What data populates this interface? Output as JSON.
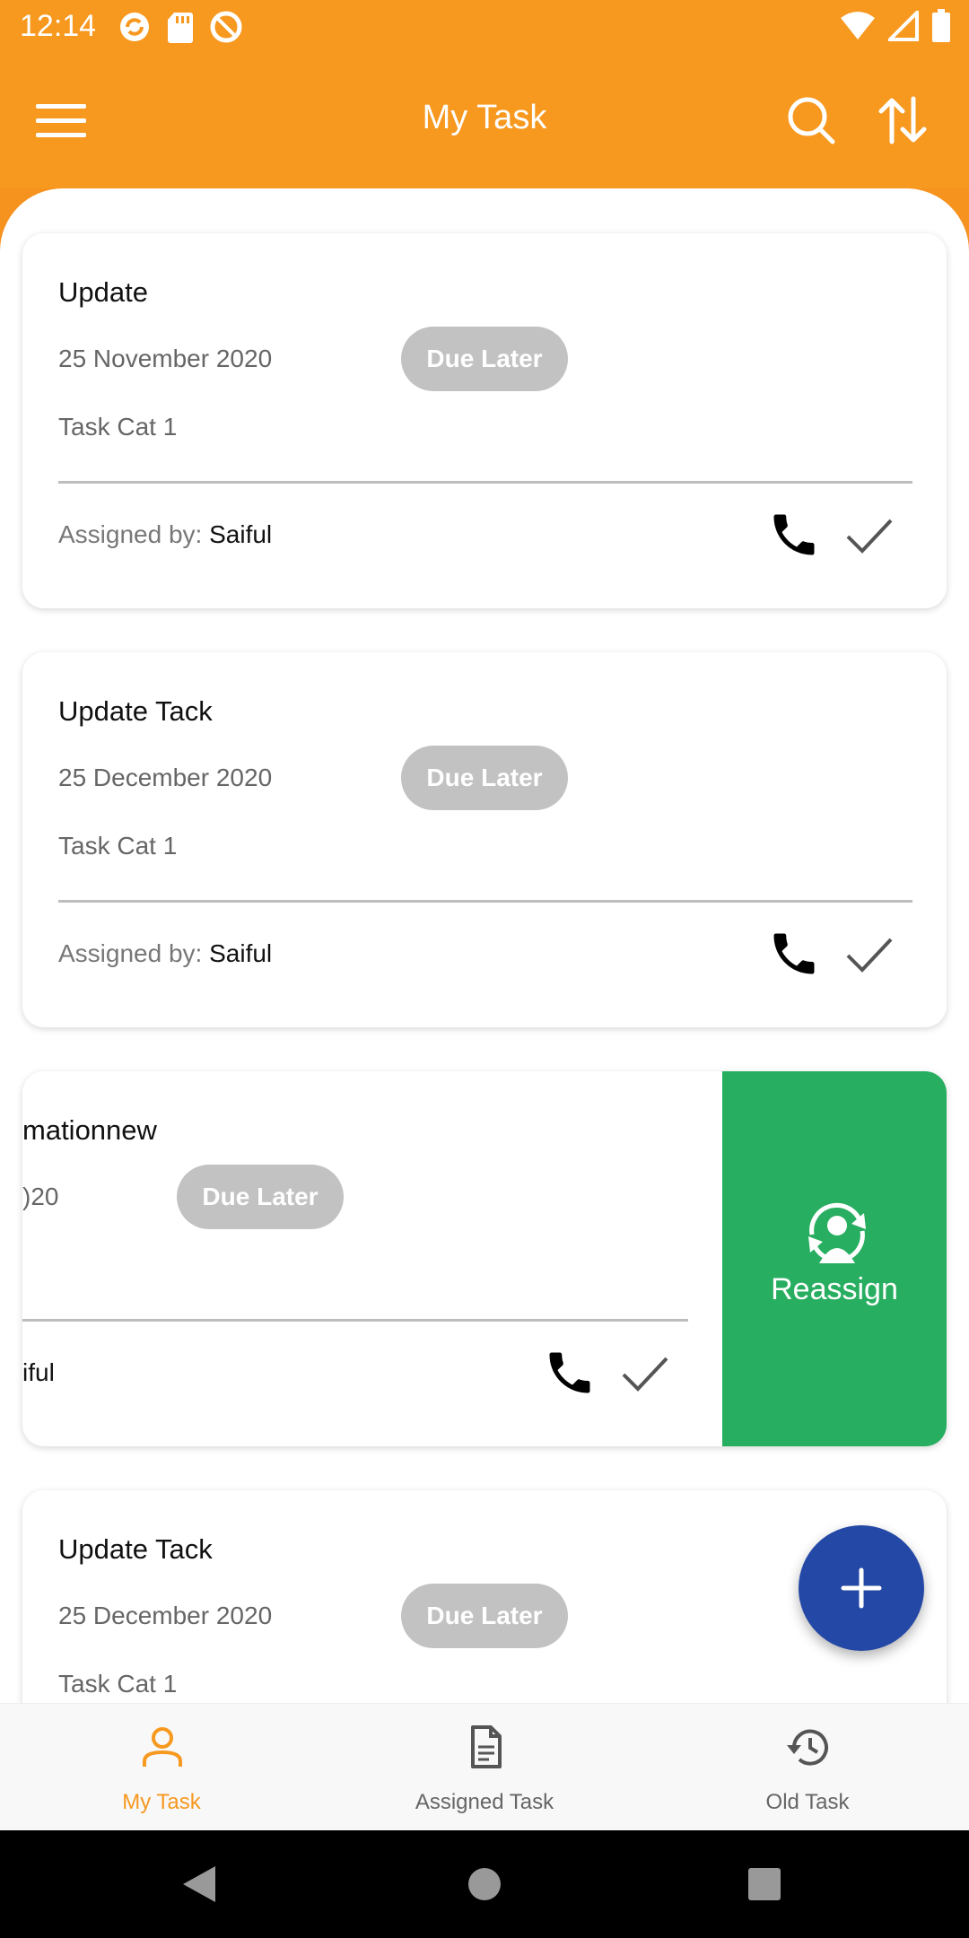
{
  "status_bar": {
    "time": "12:14"
  },
  "app_bar": {
    "title": "My Task"
  },
  "colors": {
    "primary": "#f7981f",
    "reassign": "#28ae60",
    "fab": "#2448a6",
    "badge": "#c2c2c2"
  },
  "tasks": [
    {
      "title": "Update",
      "date": "25 November 2020",
      "status": "Due Later",
      "category": "Task Cat 1",
      "assigned_label": "Assigned by: ",
      "assigned_name": "Saiful"
    },
    {
      "title": "Update Tack",
      "date": "25 December 2020",
      "status": "Due Later",
      "category": "Task Cat 1",
      "assigned_label": "Assigned by: ",
      "assigned_name": "Saiful"
    },
    {
      "title": "mationnew",
      "date": ")20",
      "status": "Due Later",
      "assigned_name": "iful",
      "action_label": "Reassign"
    },
    {
      "title": "Update Tack",
      "date": "25 December 2020",
      "status": "Due Later",
      "category": "Task Cat 1"
    }
  ],
  "bottom_nav": [
    {
      "label": "My Task",
      "icon": "person-icon",
      "active": true
    },
    {
      "label": "Assigned Task",
      "icon": "document-icon",
      "active": false
    },
    {
      "label": "Old Task",
      "icon": "history-icon",
      "active": false
    }
  ]
}
